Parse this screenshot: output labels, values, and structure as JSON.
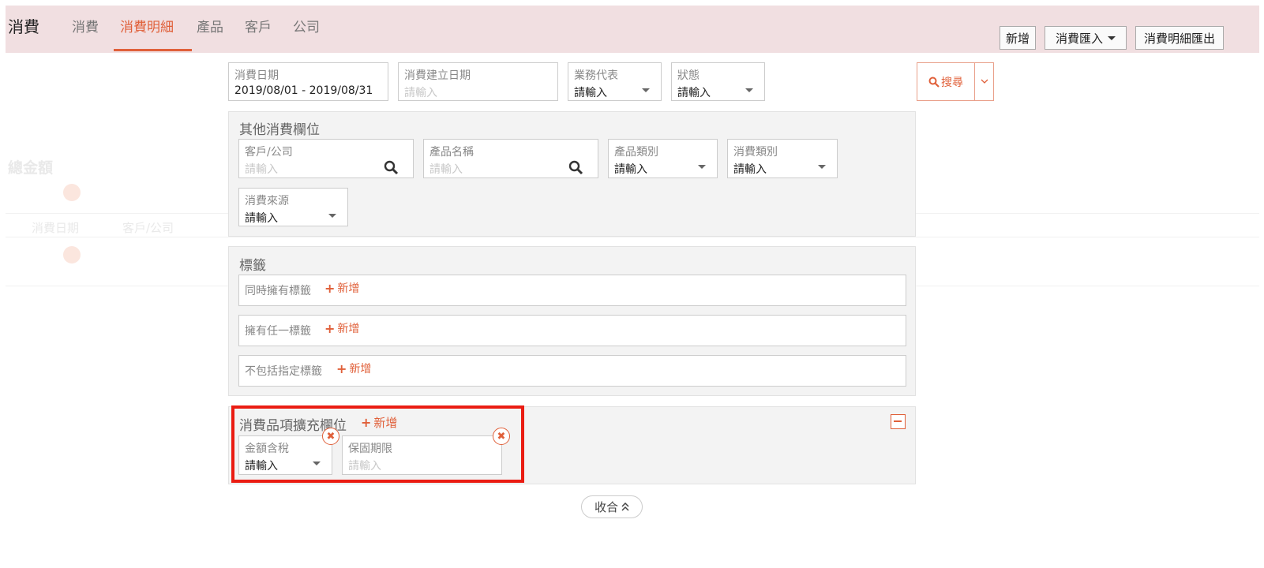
{
  "app": {
    "title": "消費"
  },
  "nav": {
    "tabs": [
      {
        "label": "消費",
        "active": false
      },
      {
        "label": "消費明細",
        "active": true
      },
      {
        "label": "產品",
        "active": false
      },
      {
        "label": "客戶",
        "active": false
      },
      {
        "label": "公司",
        "active": false
      }
    ]
  },
  "toolbar": {
    "add_label": "新增",
    "import_label": "消費匯入",
    "export_label": "消費明細匯出"
  },
  "colors": {
    "accent": "#e0603a",
    "highlight": "#ea1c12",
    "topbar": "#f1dfe1"
  },
  "filters": {
    "consume_date": {
      "label": "消費日期",
      "value": "2019/08/01 - 2019/08/31"
    },
    "created_date": {
      "label": "消費建立日期",
      "placeholder": "請輸入"
    },
    "sales_rep": {
      "label": "業務代表",
      "value": "請輸入"
    },
    "status": {
      "label": "狀態",
      "value": "請輸入"
    }
  },
  "search": {
    "label": "搜尋",
    "icon": "search-icon"
  },
  "other_fields": {
    "title": "其他消費欄位",
    "customer": {
      "label": "客戶/公司",
      "placeholder": "請輸入"
    },
    "product_name": {
      "label": "產品名稱",
      "placeholder": "請輸入"
    },
    "product_category": {
      "label": "產品類別",
      "value": "請輸入"
    },
    "consume_category": {
      "label": "消費類別",
      "value": "請輸入"
    },
    "consume_source": {
      "label": "消費來源",
      "value": "請輸入"
    }
  },
  "tags": {
    "title": "標籤",
    "rows": [
      {
        "label": "同時擁有標籤",
        "add": "新增"
      },
      {
        "label": "擁有任一標籤",
        "add": "新增"
      },
      {
        "label": "不包括指定標籤",
        "add": "新增"
      }
    ]
  },
  "extension": {
    "title": "消費品項擴充欄位",
    "add": "新增",
    "tax_included": {
      "label": "金額含稅",
      "value": "請輸入"
    },
    "warranty": {
      "label": "保固期限",
      "placeholder": "請輸入"
    }
  },
  "collapse": {
    "label": "收合"
  }
}
